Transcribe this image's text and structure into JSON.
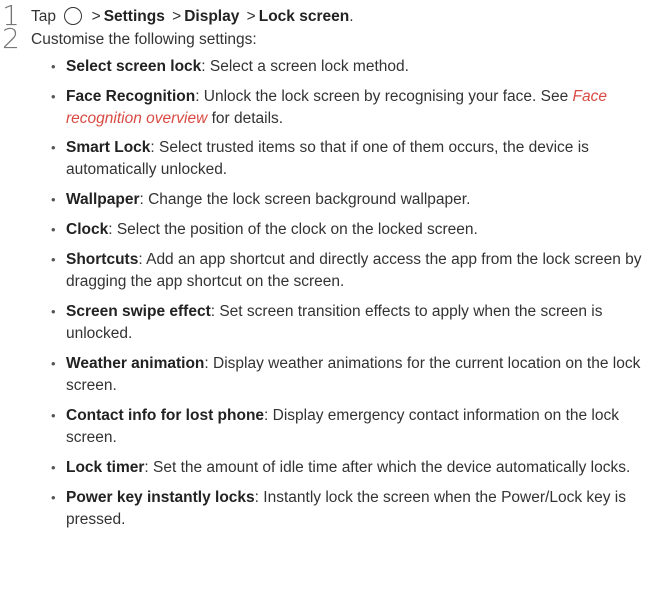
{
  "step1": {
    "number": "1",
    "tap": "Tap",
    "icon": "home-circle-icon",
    "separator": ">",
    "settings": "Settings",
    "display": "Display",
    "lock_screen": "Lock screen",
    "period": "."
  },
  "step2": {
    "number": "2",
    "text": "Customise the following settings:"
  },
  "items": [
    {
      "term": "Select screen lock",
      "desc": ": Select a screen lock method."
    },
    {
      "term": "Face Recognition",
      "desc": ": Unlock the lock screen by recognising your face. See ",
      "link": "Face recognition overview",
      "after": " for details."
    },
    {
      "term": "Smart Lock",
      "desc": ": Select trusted items so that if one of them occurs, the device is automatically unlocked."
    },
    {
      "term": "Wallpaper",
      "desc": ": Change the lock screen background wallpaper."
    },
    {
      "term": "Clock",
      "desc": ": Select the position of the clock on the locked screen."
    },
    {
      "term": "Shortcuts",
      "desc": ": Add an app shortcut and directly access the app from the lock screen by dragging the app shortcut on the screen."
    },
    {
      "term": "Screen swipe effect",
      "desc": ": Set screen transition effects to apply when the screen is unlocked."
    },
    {
      "term": "Weather animation",
      "desc": ": Display weather animations for the current location on the lock screen."
    },
    {
      "term": "Contact info for lost phone",
      "desc": ": Display emergency contact information on the lock screen."
    },
    {
      "term": "Lock timer",
      "desc": ": Set the amount of idle time after which the device automatically locks."
    },
    {
      "term": "Power key instantly locks",
      "desc": ": Instantly lock the screen when the Power/Lock key is pressed."
    }
  ]
}
